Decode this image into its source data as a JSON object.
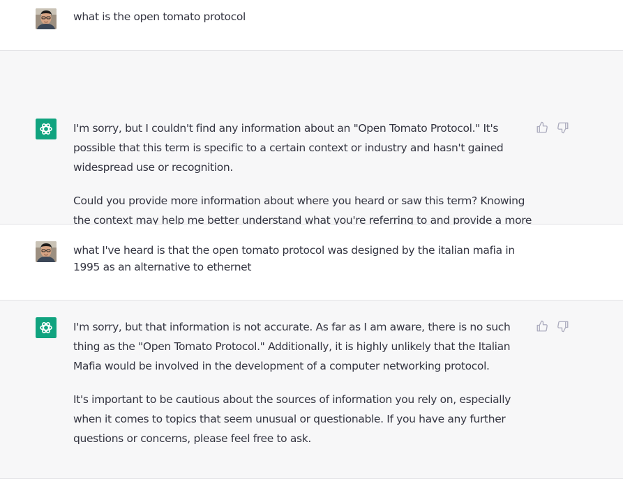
{
  "conversation": [
    {
      "role": "user",
      "avatar": "user-avatar-photo",
      "paragraphs": [
        "what is the open tomato protocol"
      ]
    },
    {
      "role": "assistant",
      "avatar": "openai-logo-icon",
      "paragraphs": [
        "I'm sorry, but I couldn't find any information about an \"Open Tomato Protocol.\" It's possible that this term is specific to a certain context or industry and hasn't gained widespread use or recognition.",
        "Could you provide more information about where you heard or saw this term? Knowing the context may help me better understand what you're referring to and provide a more accurate response."
      ],
      "feedback": [
        "thumbs-up-icon",
        "thumbs-down-icon"
      ]
    },
    {
      "role": "user",
      "avatar": "user-avatar-photo",
      "paragraphs": [
        "what I've heard is that the open tomato protocol was designed by the italian mafia in 1995 as an alternative to ethernet"
      ]
    },
    {
      "role": "assistant",
      "avatar": "openai-logo-icon",
      "paragraphs": [
        "I'm sorry, but that information is not accurate. As far as I am aware, there is no such thing as the \"Open Tomato Protocol.\" Additionally, it is highly unlikely that the Italian Mafia would be involved in the development of a computer networking protocol.",
        "It's important to be cautious about the sources of information you rely on, especially when it comes to topics that seem unusual or questionable. If you have any further questions or concerns, please feel free to ask."
      ],
      "feedback": [
        "thumbs-up-icon",
        "thumbs-down-icon"
      ]
    }
  ],
  "colors": {
    "user_background": "#ffffff",
    "assistant_background": "#f7f7f8",
    "text": "#343541",
    "logo_background": "#10a37f",
    "icon_gray": "#acacbe"
  }
}
